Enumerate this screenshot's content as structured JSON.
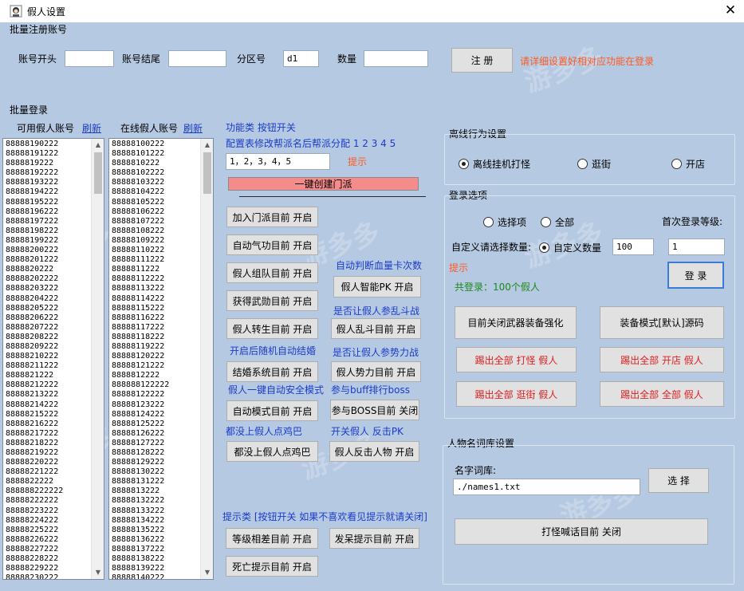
{
  "window": {
    "title": "假人设置",
    "close_glyph": "✕"
  },
  "batch_register": {
    "section_label": "批量注册账号",
    "account_start_label": "账号开头",
    "account_start_value": "",
    "account_end_label": "账号结尾",
    "account_end_value": "",
    "zone_label": "分区号",
    "zone_value": "d1",
    "count_label": "数量",
    "count_value": "",
    "register_button": "注 册",
    "hint": "请详细设置好相对应功能在登录"
  },
  "batch_login": {
    "section_label": "批量登录",
    "available_label": "可用假人账号",
    "available_refresh": "刷新",
    "online_label": "在线假人账号",
    "online_refresh": "刷新",
    "available_accounts": [
      "88888190222",
      "88888191222",
      "8888819222",
      "88888192222",
      "88888193222",
      "88888194222",
      "88888195222",
      "88888196222",
      "88888197222",
      "88888198222",
      "88888199222",
      "88888200222",
      "88888201222",
      "8888820222",
      "88888202222",
      "88888203222",
      "88888204222",
      "88888205222",
      "88888206222",
      "88888207222",
      "88888208222",
      "88888209222",
      "88888210222",
      "88888211222",
      "8888821222",
      "88888212222",
      "88888213222",
      "88888214222",
      "88888215222",
      "88888216222",
      "88888217222",
      "88888218222",
      "88888219222",
      "88888220222",
      "88888221222",
      "8888822222",
      "888888222222",
      "88888222222",
      "88888223222",
      "88888224222",
      "88888225222",
      "88888226222",
      "88888227222",
      "88888228222",
      "88888229222",
      "88888230222"
    ],
    "online_accounts": [
      "88888100222",
      "88888101222",
      "8888810222",
      "88888102222",
      "88888103222",
      "88888104222",
      "88888105222",
      "88888106222",
      "88888107222",
      "88888108222",
      "88888109222",
      "88888110222",
      "88888111222",
      "8888811222",
      "88888112222",
      "88888113222",
      "88888114222",
      "88888115222",
      "88888116222",
      "88888117222",
      "88888118222",
      "88888119222",
      "88888120222",
      "88888121222",
      "8888812222",
      "888888122222",
      "88888122222",
      "88888123222",
      "88888124222",
      "88888125222",
      "88888126222",
      "88888127222",
      "88888128222",
      "88888129222",
      "88888130222",
      "88888131222",
      "8888813222",
      "88888132222",
      "88888133222",
      "88888134222",
      "88888135222",
      "88888136222",
      "88888137222",
      "88888138222",
      "88888139222",
      "88888140222"
    ]
  },
  "functions": {
    "header": "功能类 按钮开关",
    "faction_hint": "配置表修改帮派名后帮派分配 1 2 3 4 5",
    "faction_input": "1，2，3，4，5",
    "faction_tip": "提示",
    "create_faction_button": "一键创建门派",
    "buttons_left": [
      "加入门派目前 开启",
      "自动气功目前 开启",
      "假人组队目前 开启",
      "获得武勋目前 开启",
      "假人转生目前 开启",
      "结婚系统目前 开启",
      "自动模式目前 开启",
      "都没上假人点鸡巴"
    ],
    "notes": [
      "自动判断血量卡次数",
      "是否让假人参乱斗战",
      "开启后随机自动结婚",
      "是否让假人参势力战",
      "假人一键自动安全模式",
      "参与buff排行boss",
      "都没上假人点鸡巴",
      "开关假人 反击PK"
    ],
    "buttons_right": [
      "假人智能PK 开启",
      "假人乱斗目前 开启",
      "假人势力目前 开启",
      "参与BOSS目前 关闭",
      "假人反击人物 开启"
    ],
    "tips_header": "提示类 [按钮开关 如果不喜欢看见提示就请关闭]",
    "tip_buttons": [
      "等级相差目前 开启",
      "发呆提示目前 开启",
      "死亡提示目前 开启"
    ]
  },
  "offline": {
    "title": "离线行为设置",
    "options": [
      "离线挂机打怪",
      "逛街",
      "开店"
    ],
    "selected": "离线挂机打怪"
  },
  "login_options": {
    "title": "登录选项",
    "opt_select": "选择项",
    "opt_all": "全部",
    "first_level_label": "首次登录等级:",
    "custom_label": "自定义请选择数量:",
    "custom_radio": "自定义数量",
    "custom_value": "100",
    "level_value": "1",
    "login_button": "登 录",
    "tip": "提示",
    "total": "共登录：100个假人",
    "action_buttons": [
      "目前关闭武器装备强化",
      "装备模式[默认]源码",
      "踢出全部 打怪 假人",
      "踢出全部 开店 假人",
      "踢出全部 逛街 假人",
      "踢出全部 全部 假人"
    ]
  },
  "names": {
    "title": "人物名词库设置",
    "library_label": "名字词库:",
    "library_value": "./names1.txt",
    "choose_button": "选 择",
    "shout_button": "打怪喊话目前 关闭"
  },
  "watermark": {
    "cn": "游多多",
    "en": "Youdd.Net"
  }
}
